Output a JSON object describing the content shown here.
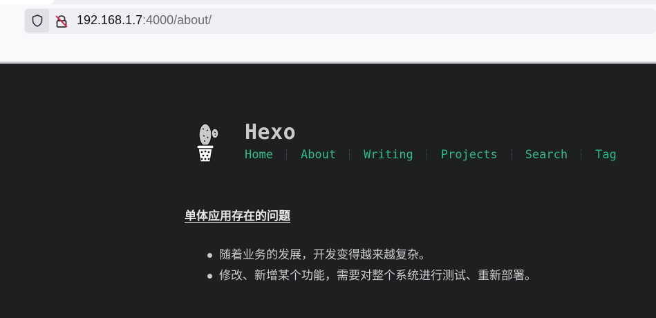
{
  "browser": {
    "url_host": "192.168.1.7",
    "url_rest": ":4000/about/"
  },
  "site": {
    "title": "Hexo",
    "nav": [
      "Home",
      "About",
      "Writing",
      "Projects",
      "Search",
      "Tag"
    ]
  },
  "content": {
    "heading": "单体应用存在的问题",
    "bullets": [
      "随着业务的发展，开发变得越来越复杂。",
      "修改、新增某个功能，需要对整个系统进行测试、重新部署。"
    ]
  },
  "colors": {
    "page_bg": "#1d1f21",
    "link": "#2bbc8a",
    "text": "#c9cacc"
  },
  "icons": {
    "shield": "shield-icon",
    "lock": "insecure-lock-icon",
    "logo": "cactus-logo"
  }
}
